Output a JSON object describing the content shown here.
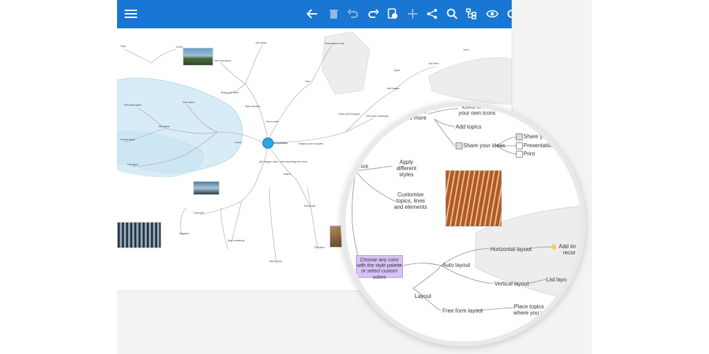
{
  "toolbar": {
    "icons": [
      "menu-icon",
      "back-arrow-icon",
      "trash-icon",
      "undo-icon",
      "redo-icon",
      "style-icon",
      "add-icon",
      "share-icon",
      "search-icon",
      "layout-icon",
      "view-icon",
      "settings-icon"
    ]
  },
  "colors": {
    "toolbar": "#1976d2",
    "accent": "#2aa7e6",
    "callout": "#d7c2f5",
    "region_blue": "#d7ecf7"
  },
  "mindmap": {
    "central_label": "SimpleMind",
    "branches": [
      "Layout",
      "Share your thoughts",
      "Organize your thoughts",
      "Add images, video, voice recordings and more",
      "Style selection",
      "How to start"
    ],
    "small_labels": [
      "Add layout",
      "Auto layout",
      "Horizontal layout",
      "Vertical layout",
      "List layout",
      "Free form layout",
      "Add topics",
      "Share your ideas",
      "Presentation mode",
      "Print",
      "Add images",
      "Add video",
      "Add voice recordings",
      "Customize",
      "Auto numbering",
      "Show Hide",
      "Move topics",
      "Checkbox",
      "Style",
      "Colors",
      "Relations",
      "Notes",
      "Icons",
      "Outline"
    ]
  },
  "magnifier": {
    "top_text_1": ", voice",
    "top_text_2": "and more",
    "icons_text": "icons or add your own icons",
    "add_topics": "Add topics",
    "share_ideas": "Share your ideas",
    "share_sub": [
      "Share yo",
      "Presentation",
      "Print"
    ],
    "apply_styles": "Apply different styles",
    "customise": "Customise topics, lines and elements",
    "nce": "nce",
    "callout": "Choose any color with the style palette or select custom colors",
    "auto_layout": "Auto layout",
    "horizontal_layout": "Horizontal layout",
    "add_images": "Add im",
    "record": "recor",
    "vertical_layout": "Vertical layout",
    "list_layout": "List layo",
    "layout": "Layout",
    "free_form": "Free form layout",
    "place_topics": "Place topics where you w"
  }
}
